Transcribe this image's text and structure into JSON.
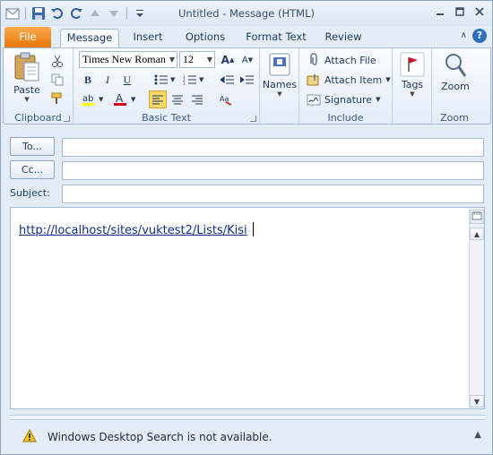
{
  "window": {
    "title": "Untitled - Message (HTML)"
  },
  "tabs": [
    "File",
    "Message",
    "Insert",
    "Options",
    "Format Text",
    "Review"
  ],
  "ribbon": {
    "clipboard": {
      "paste": "Paste",
      "label": "Clipboard"
    },
    "basic_text": {
      "font": "Times New Roman",
      "size": "12",
      "label": "Basic Text"
    },
    "names": {
      "label": "Names"
    },
    "include": {
      "attach_file": "Attach File",
      "attach_item": "Attach Item",
      "signature": "Signature",
      "label": "Include"
    },
    "tags": {
      "label": "Tags"
    },
    "zoom": {
      "button": "Zoom",
      "label": "Zoom"
    }
  },
  "header": {
    "to": "To...",
    "cc": "Cc...",
    "subject": "Subject:"
  },
  "body": {
    "text": "http://localhost/sites/vuktest2/Lists/Kisi"
  },
  "infobar": {
    "message": "Windows Desktop Search is not available."
  },
  "colors": {
    "accent_file_tab": "#e7760c",
    "link": "#0f2c8f",
    "help": "#2c6fbf"
  }
}
